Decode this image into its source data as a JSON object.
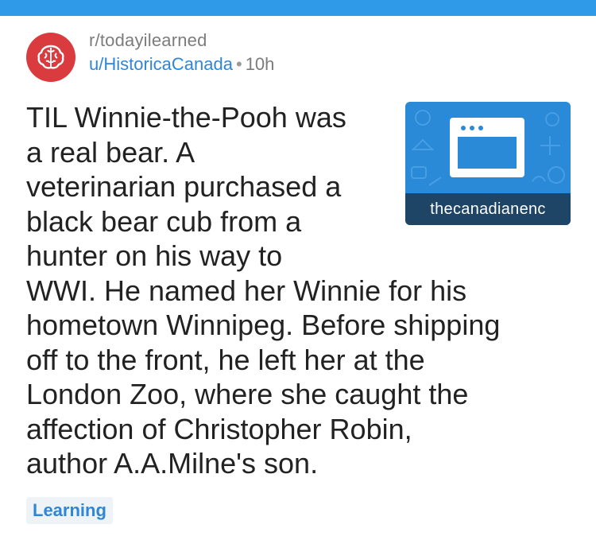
{
  "header": {
    "subreddit": "r/todayilearned",
    "author": "u/HistoricaCanada",
    "separator": "•",
    "time": "10h",
    "icon": "brain-icon"
  },
  "post": {
    "title_lines": [
      "TIL Winnie-the-Pooh was",
      "a real bear. A",
      "veterinarian purchased a",
      "black bear cub from a",
      "hunter on his way to",
      "WWI. He named her Winnie for his",
      "hometown Winnipeg. Before shipping",
      "off to the front, he left her at the",
      "London Zoo, where she caught the",
      "affection of Christopher Robin,",
      "author A.A.Milne's son."
    ],
    "thumbnail": {
      "caption": "thecanadianenc",
      "icon": "browser-window-icon"
    },
    "flair": "Learning"
  },
  "colors": {
    "top_bar": "#2f9ae8",
    "subreddit_icon_bg": "#d93b3e",
    "link_blue": "#2f86d6",
    "thumb_blue": "#2a8ad8",
    "thumb_caption_bg": "#1e4466"
  }
}
